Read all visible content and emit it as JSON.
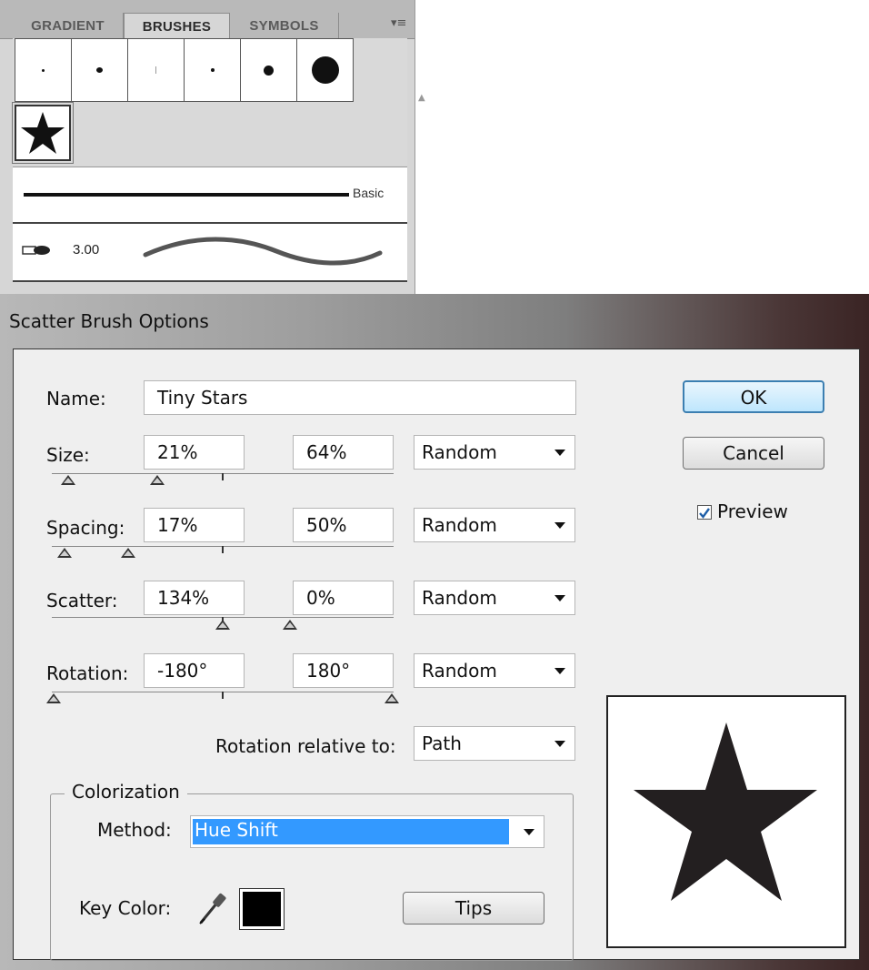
{
  "brushes_panel": {
    "tabs": [
      "GRADIENT",
      "BRUSHES",
      "SYMBOLS"
    ],
    "active_tab": "BRUSHES",
    "menu_icon": "panel-menu-icon",
    "basic_brush_label": "Basic",
    "calligraphic_size": "3.00"
  },
  "dialog": {
    "title": "Scatter Brush Options",
    "name": {
      "label": "Name:",
      "value": "Tiny Stars"
    },
    "rows": [
      {
        "label": "Size:",
        "min": "21%",
        "max": "64%",
        "mode": "Random"
      },
      {
        "label": "Spacing:",
        "min": "17%",
        "max": "50%",
        "mode": "Random"
      },
      {
        "label": "Scatter:",
        "min": "134%",
        "max": "0%",
        "mode": "Random"
      },
      {
        "label": "Rotation:",
        "min": "-180°",
        "max": "180°",
        "mode": "Random"
      }
    ],
    "rotation_relative": {
      "label": "Rotation relative to:",
      "value": "Path"
    },
    "colorization": {
      "legend": "Colorization",
      "method_label": "Method:",
      "method_value": "Hue Shift",
      "key_color_label": "Key Color:",
      "key_color": "#000000",
      "tips_button": "Tips"
    },
    "buttons": {
      "ok": "OK",
      "cancel": "Cancel"
    },
    "preview": {
      "label": "Preview",
      "checked": true
    }
  }
}
